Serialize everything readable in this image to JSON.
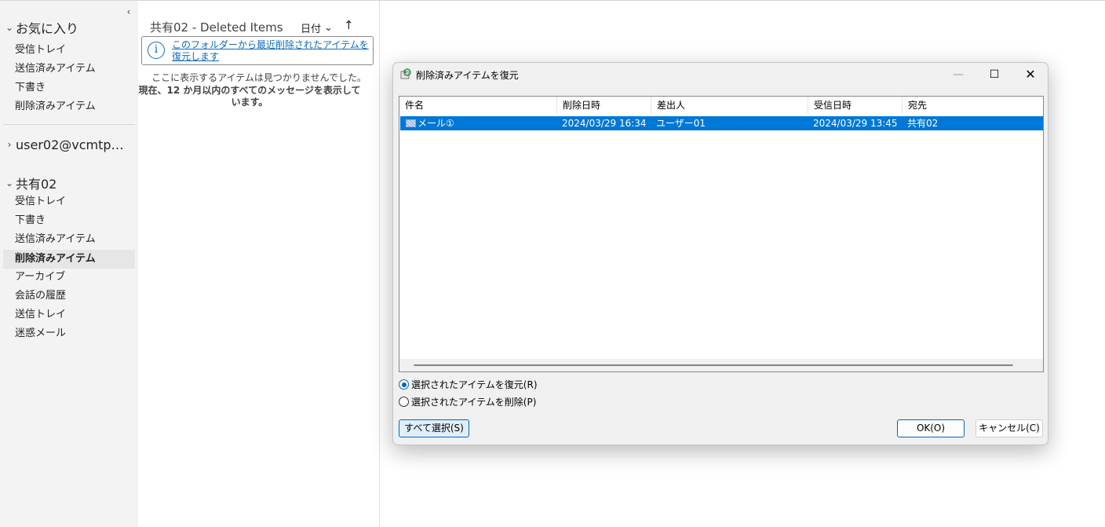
{
  "nav": {
    "collapse_glyph": "‹",
    "favorites": {
      "label": "お気に入り",
      "items": [
        "受信トレイ",
        "送信済みアイテム",
        "下書き",
        "削除済みアイテム"
      ]
    },
    "account": {
      "label": "user02@vcmtp…"
    },
    "shared": {
      "label": "共有02",
      "items": [
        "受信トレイ",
        "下書き",
        "送信済みアイテム",
        "削除済みアイテム",
        "アーカイブ",
        "会話の履歴",
        "送信トレイ",
        "迷惑メール"
      ],
      "selected_index": 3
    }
  },
  "list": {
    "folder_title": "共有02 - Deleted Items",
    "sort_label": "日付",
    "sort_direction_glyph": "↑",
    "info_link": "このフォルダーから最近削除されたアイテムを復元します",
    "empty_message": "ここに表示するアイテムは見つかりませんでした。",
    "empty_detail": "現在、12 か月以内のすべてのメッセージを表示しています。"
  },
  "dialog": {
    "title": "削除済みアイテムを復元",
    "columns": [
      "件名",
      "削除日時",
      "差出人",
      "受信日時",
      "宛先"
    ],
    "rows": [
      {
        "subject": "メール①",
        "deleted": "2024/03/29 16:34",
        "from": "ユーザー01",
        "received": "2024/03/29 13:45",
        "to": "共有02"
      }
    ],
    "radio_restore": "選択されたアイテムを復元(R)",
    "radio_delete": "選択されたアイテムを削除(P)",
    "restore_selected": true,
    "btn_select_all": "すべて選択(S)",
    "btn_ok": "OK(O)",
    "btn_cancel": "キャンセル(C)"
  },
  "colors": {
    "accent": "#0078d7",
    "link": "#0f6cbd",
    "nav_bg": "#f3f3f3"
  }
}
